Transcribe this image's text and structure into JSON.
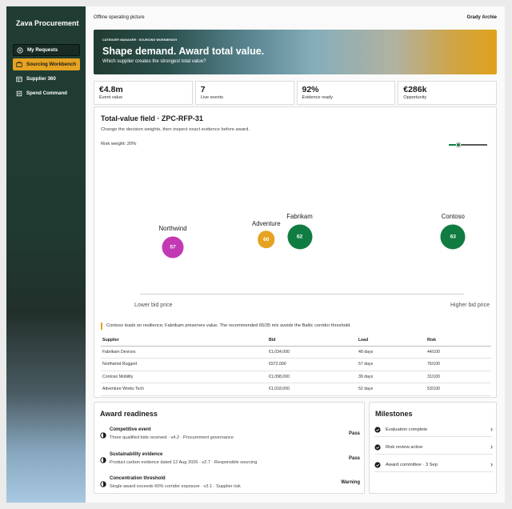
{
  "app": {
    "brand": "Zava Procurement"
  },
  "sidebar": {
    "items": [
      {
        "label": "My Requests",
        "icon": "request-icon"
      },
      {
        "label": "Sourcing Workbench",
        "icon": "workbench-icon"
      },
      {
        "label": "Supplier 360",
        "icon": "supplier-icon"
      },
      {
        "label": "Spend Command",
        "icon": "spend-icon"
      }
    ],
    "active_index": 1
  },
  "topbar": {
    "status": "Offline operating picture",
    "user": "Grady Archie"
  },
  "hero": {
    "kicker": "CATEGORY MANAGER · SOURCING WORKBENCH",
    "title": "Shape demand. Award total value.",
    "subtitle": "Which supplier creates the strongest total value?"
  },
  "kpis": [
    {
      "value": "€4.8m",
      "label": "Event value"
    },
    {
      "value": "7",
      "label": "Live events"
    },
    {
      "value": "92%",
      "label": "Evidence ready"
    },
    {
      "value": "€286k",
      "label": "Opportunity"
    }
  ],
  "field": {
    "title": "Total-value field · ZPC-RFP-31",
    "description": "Change the decision weights, then inspect exact evidence before award.",
    "risk_label": "Risk weight: 20%",
    "risk_weight": 0.2,
    "axis_left": "Lower bid price",
    "axis_right": "Higher bid price",
    "callout": "Contoso leads on resilience; Fabrikam preserves value. The recommended 65/35 mix avoids the Baltic corridor threshold."
  },
  "colors": {
    "accent": "#e5a321",
    "green": "#107c41",
    "magenta": "#c239b3",
    "dark": "#213d33"
  },
  "chart_data": {
    "type": "scatter",
    "xlabel_left": "Lower bid price",
    "xlabel_right": "Higher bid price",
    "points": [
      {
        "name": "Northwind",
        "score": 57,
        "x": 0.12,
        "y": 0.62,
        "size": 1.0,
        "color": "#c239b3"
      },
      {
        "name": "Adventure",
        "score": 60,
        "x": 0.4,
        "y": 0.57,
        "size": 0.8,
        "color": "#e5a321"
      },
      {
        "name": "Fabrikam",
        "score": 62,
        "x": 0.5,
        "y": 0.55,
        "size": 1.15,
        "color": "#107c41"
      },
      {
        "name": "Contoso",
        "score": 63,
        "x": 0.96,
        "y": 0.55,
        "size": 1.15,
        "color": "#107c41"
      }
    ]
  },
  "table": {
    "headers": [
      "Supplier",
      "Bid",
      "Lead",
      "Risk"
    ],
    "rows": [
      [
        "Fabrikam Devices",
        "€1,034,000",
        "48 days",
        "44/100"
      ],
      [
        "Northwind Rugged",
        "€972,000",
        "57 days",
        "76/100"
      ],
      [
        "Contoso Mobility",
        "€1,098,000",
        "39 days",
        "31/100"
      ],
      [
        "Adventure Works Tech",
        "€1,018,000",
        "52 days",
        "53/100"
      ]
    ]
  },
  "readiness": {
    "title": "Award readiness",
    "items": [
      {
        "title": "Competitive event",
        "detail": "Three qualified bids received · v4.2 · Procurement governance",
        "status": "Pass"
      },
      {
        "title": "Sustainability evidence",
        "detail": "Product carbon evidence dated 12 Aug 2026 · v2.7 · Responsible sourcing",
        "status": "Pass"
      },
      {
        "title": "Concentration threshold",
        "detail": "Single award exceeds 60% corridor exposure · v3.1 · Supplier risk",
        "status": "Warning"
      }
    ]
  },
  "milestones": {
    "title": "Milestones",
    "items": [
      {
        "label": "Evaluation complete"
      },
      {
        "label": "Risk review active"
      },
      {
        "label": "Award committee · 3 Sep"
      }
    ]
  }
}
